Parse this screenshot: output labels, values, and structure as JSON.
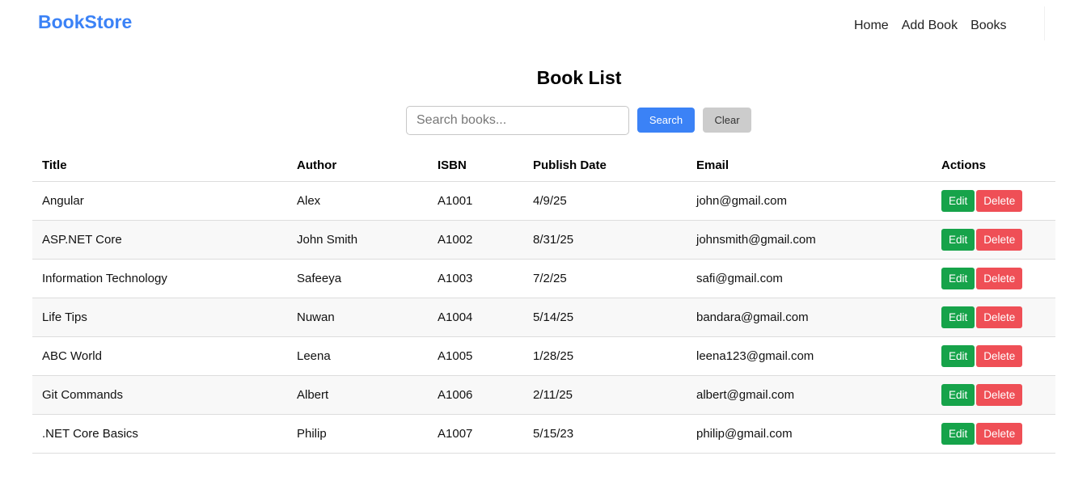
{
  "header": {
    "brand": "BookStore",
    "nav": [
      {
        "label": "Home"
      },
      {
        "label": "Add Book"
      },
      {
        "label": "Books"
      }
    ]
  },
  "main": {
    "title": "Book List",
    "search": {
      "placeholder": "Search books...",
      "value": "",
      "search_label": "Search",
      "clear_label": "Clear"
    },
    "table": {
      "columns": [
        "Title",
        "Author",
        "ISBN",
        "Publish Date",
        "Email",
        "Actions"
      ],
      "edit_label": "Edit",
      "delete_label": "Delete",
      "rows": [
        {
          "title": "Angular",
          "author": "Alex",
          "isbn": "A1001",
          "date": "4/9/25",
          "email": "john@gmail.com"
        },
        {
          "title": "ASP.NET Core",
          "author": "John Smith",
          "isbn": "A1002",
          "date": "8/31/25",
          "email": "johnsmith@gmail.com"
        },
        {
          "title": "Information Technology",
          "author": "Safeeya",
          "isbn": "A1003",
          "date": "7/2/25",
          "email": "safi@gmail.com"
        },
        {
          "title": "Life Tips",
          "author": "Nuwan",
          "isbn": "A1004",
          "date": "5/14/25",
          "email": "bandara@gmail.com"
        },
        {
          "title": "ABC World",
          "author": "Leena",
          "isbn": "A1005",
          "date": "1/28/25",
          "email": "leena123@gmail.com"
        },
        {
          "title": "Git Commands",
          "author": "Albert",
          "isbn": "A1006",
          "date": "2/11/25",
          "email": "albert@gmail.com"
        },
        {
          "title": ".NET Core Basics",
          "author": "Philip",
          "isbn": "A1007",
          "date": "5/15/23",
          "email": "philip@gmail.com"
        }
      ]
    }
  },
  "colors": {
    "brand": "#3b82f6",
    "search_button": "#3b82f6",
    "clear_button": "#cccccc",
    "edit_button": "#16a34a",
    "delete_button": "#ef4f56"
  }
}
